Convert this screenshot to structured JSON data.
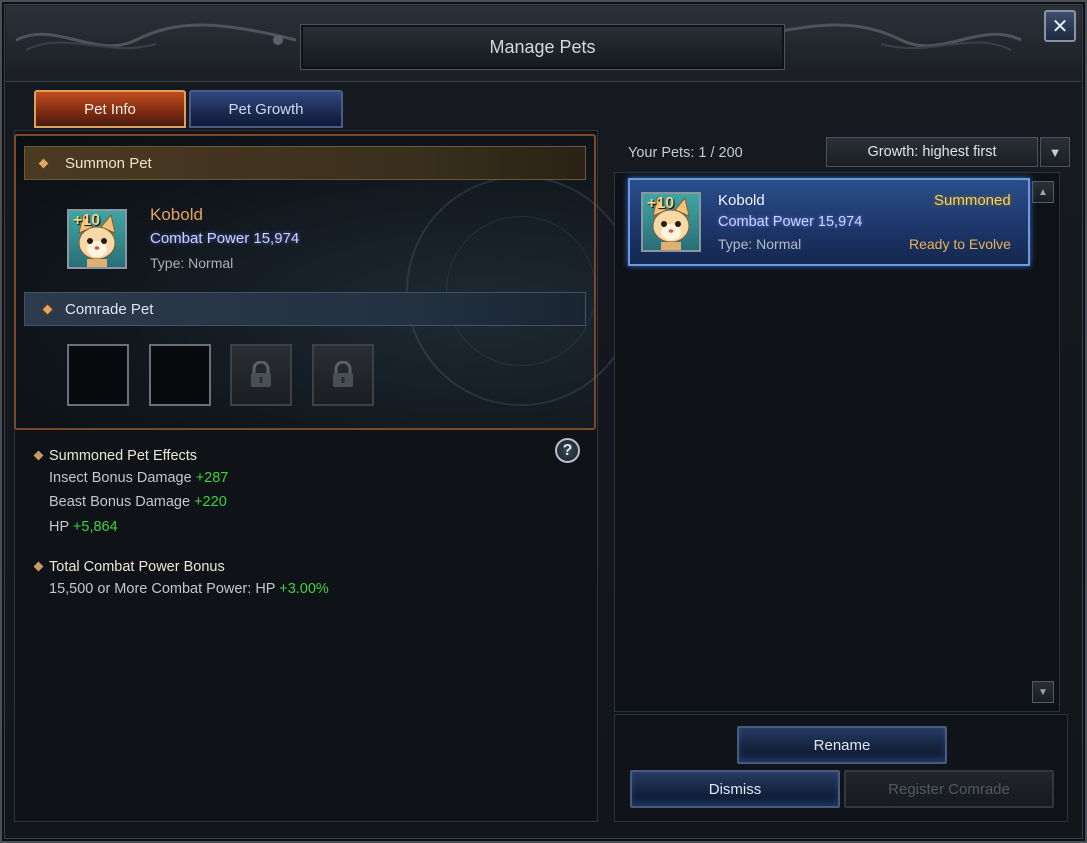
{
  "window": {
    "title": "Manage Pets"
  },
  "tabs": [
    {
      "label": "Pet Info",
      "active": true
    },
    {
      "label": "Pet Growth",
      "active": false
    }
  ],
  "summon_section": {
    "header": "Summon Pet",
    "pet": {
      "badge": "+10",
      "name": "Kobold",
      "combat_power": "Combat Power 15,974",
      "type": "Type: Normal"
    }
  },
  "comrade_section": {
    "header": "Comrade Pet",
    "slots": [
      "empty",
      "empty",
      "locked",
      "locked"
    ]
  },
  "effects": {
    "title": "Summoned Pet Effects",
    "lines": [
      {
        "label": "Insect Bonus Damage ",
        "value": "+287"
      },
      {
        "label": "Beast Bonus Damage ",
        "value": "+220"
      },
      {
        "label": "HP ",
        "value": "+5,864"
      }
    ]
  },
  "combat_bonus": {
    "title": "Total Combat Power Bonus",
    "line_label": "15,500 or More Combat Power: HP ",
    "line_value": "+3.00%"
  },
  "pet_list": {
    "count": "Your Pets: 1 / 200",
    "sort": "Growth: highest first",
    "items": [
      {
        "badge": "+10",
        "name": "Kobold",
        "combat_power": "Combat Power 15,974",
        "type": "Type: Normal",
        "status": "Summoned",
        "evolve": "Ready to Evolve"
      }
    ]
  },
  "actions": {
    "rename": "Rename",
    "dismiss": "Dismiss",
    "register": "Register Comrade"
  },
  "colors": {
    "accent_green": "#3fd13f",
    "status_yellow": "#f3d464",
    "name_orange": "#e7a25a"
  },
  "icons": {
    "close": "close-icon",
    "help": "help-icon",
    "lock": "lock-icon",
    "dropdown": "chevron-down-icon"
  }
}
